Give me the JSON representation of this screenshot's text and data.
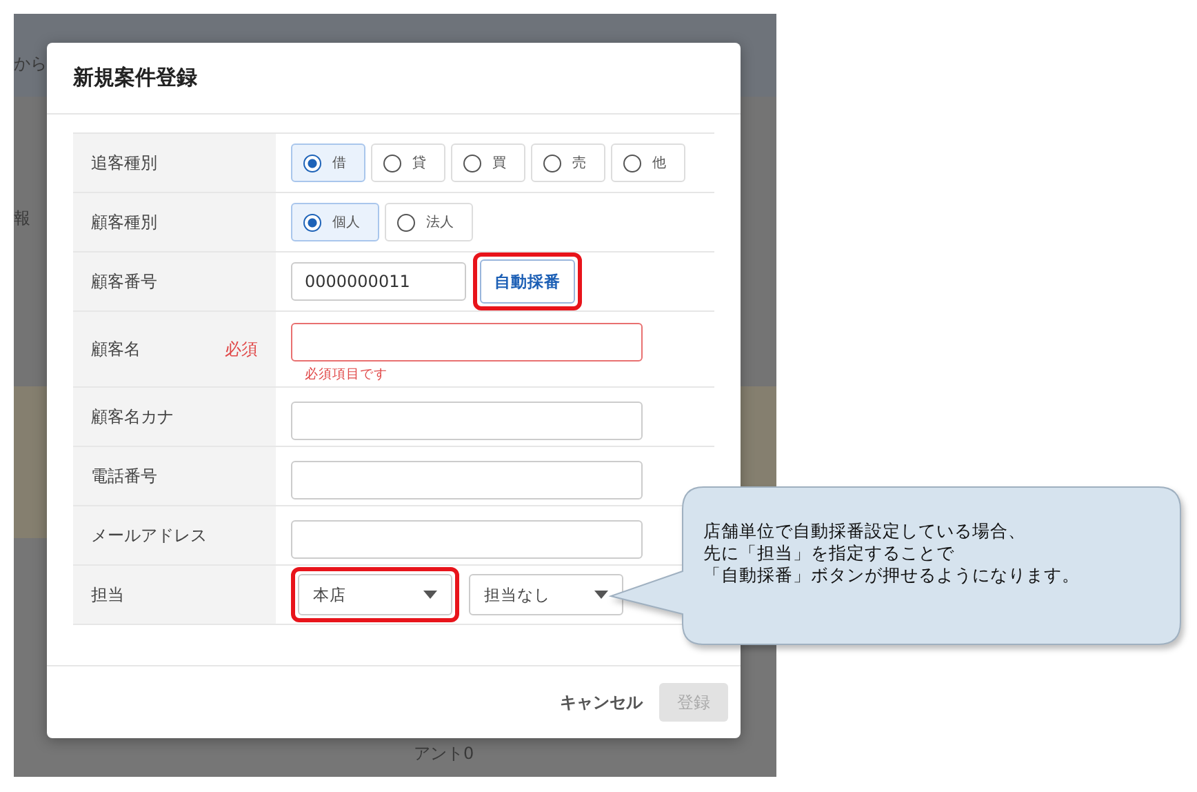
{
  "backdrop": {
    "texts": [
      "から",
      "報",
      "アント0"
    ]
  },
  "dialog": {
    "title": "新規案件登録",
    "fields": [
      {
        "kind": "radio",
        "label": "追客種別",
        "options": [
          {
            "label": "借",
            "selected": true
          },
          {
            "label": "貸",
            "selected": false
          },
          {
            "label": "買",
            "selected": false
          },
          {
            "label": "売",
            "selected": false
          },
          {
            "label": "他",
            "selected": false
          }
        ]
      },
      {
        "kind": "radio",
        "label": "顧客種別",
        "options": [
          {
            "label": "個人",
            "selected": true
          },
          {
            "label": "法人",
            "selected": false
          }
        ]
      },
      {
        "kind": "number",
        "label": "顧客番号",
        "value": "0000000011",
        "button": "自動採番",
        "highlighted": true
      },
      {
        "kind": "text",
        "label": "顧客名",
        "required": "必須",
        "error": "必須項目です"
      },
      {
        "kind": "text",
        "label": "顧客名カナ"
      },
      {
        "kind": "text",
        "label": "電話番号"
      },
      {
        "kind": "text",
        "label": "メールアドレス"
      },
      {
        "kind": "selects",
        "label": "担当",
        "selects": [
          {
            "value": "本店",
            "highlighted": true
          },
          {
            "value": "担当なし",
            "highlighted": false
          }
        ]
      }
    ],
    "cancel": "キャンセル",
    "submit": {
      "label": "登録",
      "disabled": true
    }
  },
  "callout": {
    "lines": [
      "店舗単位で自動採番設定している場合、",
      "先に「担当」を指定することで",
      "「自動採番」ボタンが押せるようになります。"
    ]
  }
}
